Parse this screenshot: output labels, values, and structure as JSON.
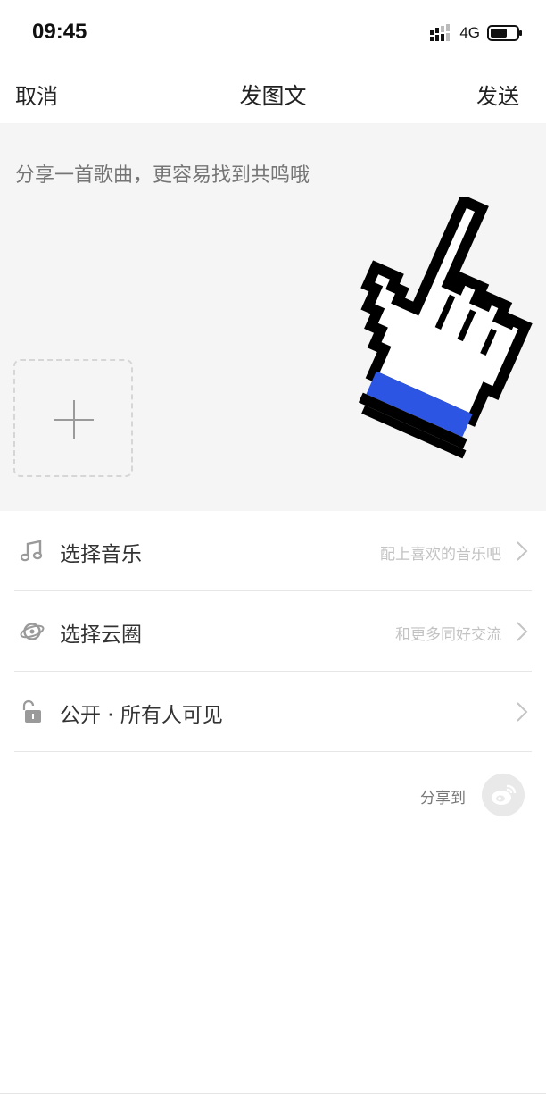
{
  "status_bar": {
    "time": "09:45",
    "network": "4G",
    "signal_icon": "signal-bars-icon",
    "battery_icon": "battery-icon"
  },
  "nav": {
    "cancel": "取消",
    "title": "发图文",
    "send": "发送"
  },
  "compose": {
    "placeholder": "分享一首歌曲，更容易找到共鸣哦",
    "add_image_icon": "plus-icon"
  },
  "options": [
    {
      "icon": "music-note-icon",
      "label": "选择音乐",
      "hint": "配上喜欢的音乐吧"
    },
    {
      "icon": "planet-icon",
      "label": "选择云圈",
      "hint": "和更多同好交流"
    },
    {
      "icon": "unlock-icon",
      "label": "公开 · 所有人可见",
      "hint": ""
    }
  ],
  "share": {
    "label": "分享到",
    "icon": "weibo-icon"
  },
  "overlay": {
    "icon": "pointing-hand-cursor-icon",
    "cuff_color": "#2d55e3"
  }
}
